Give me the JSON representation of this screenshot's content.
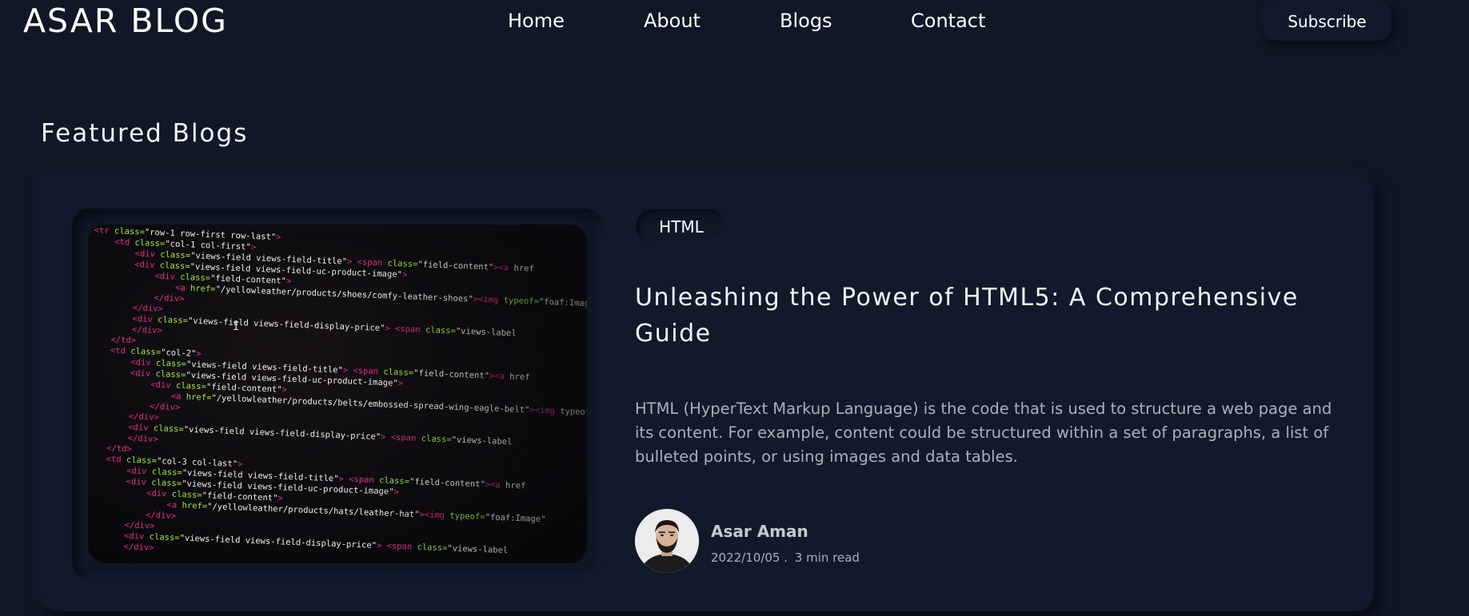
{
  "header": {
    "logo": "ASAR BLOG",
    "nav": [
      {
        "label": "Home"
      },
      {
        "label": "About"
      },
      {
        "label": "Blogs"
      },
      {
        "label": "Contact"
      }
    ],
    "subscribe_label": "Subscribe"
  },
  "featured": {
    "heading": "Featured Blogs",
    "post": {
      "tag": "HTML",
      "title": "Unleashing the Power of HTML5: A Comprehensive Guide",
      "excerpt": "HTML (HyperText Markup Language) is the code that is used to structure a web page and its content. For example, content could be structured within a set of paragraphs, a list of bulleted points, or using images and data tables.",
      "author": "Asar Aman",
      "date": "2022/10/05 .",
      "read_time": "3 min read",
      "code_lines": [
        "<tr class=\"row-1 row-first row-last\">",
        "<td class=\"col-1 col-first\">",
        "<div class=\"views-field views-field-title\"> <span class=\"field-content\"><a href",
        "<div class=\"views-field views-field-uc-product-image\">",
        "<div class=\"field-content\">",
        "<a href=\"/yellowleather/products/shoes/comfy-leather-shoes\"><img typeof=\"foaf:Image\"",
        "</div>",
        "</div>",
        "<div class=\"views-field views-field-display-price\"> <span class=\"views-label",
        "</div>",
        "</td>",
        "<td class=\"col-2\">",
        "<div class=\"views-field views-field-title\"> <span class=\"field-content\"><a href",
        "<div class=\"views-field views-field-uc-product-image\">",
        "<div class=\"field-content\">",
        "<a href=\"/yellowleather/products/belts/embossed-spread-wing-eagle-belt\"><img typeof",
        "</div>",
        "</div>",
        "<div class=\"views-field views-field-display-price\"> <span class=\"views-label",
        "</div>",
        "</td>",
        "<td class=\"col-3 col-last\">",
        "<div class=\"views-field views-field-title\"> <span class=\"field-content\"><a href",
        "<div class=\"views-field views-field-uc-product-image\">",
        "<div class=\"field-content\">",
        "<a href=\"/yellowleather/products/hats/leather-hat\"><img typeof=\"foaf:Image\"",
        "</div>",
        "</div>",
        "<div class=\"views-field views-field-display-price\"> <span class=\"views-label",
        "</div>"
      ]
    }
  },
  "colors": {
    "background": "#101827",
    "card": "#111a2a",
    "code_tag": "#e0308a",
    "code_attr": "#9ee84a",
    "code_text": "#e6eadf"
  }
}
